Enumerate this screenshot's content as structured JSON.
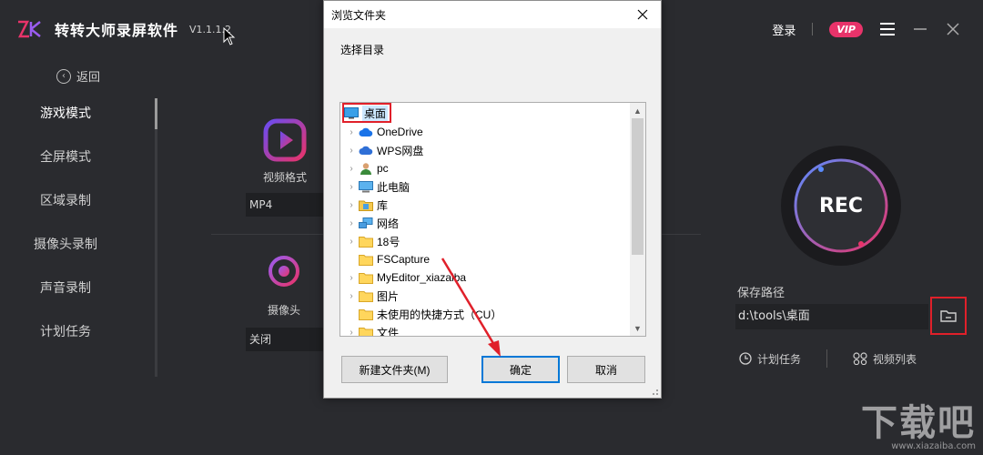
{
  "app": {
    "title": "转转大师录屏软件",
    "version": "V1.1.1.2",
    "login": "登录",
    "vip": "VIP",
    "back": "返回"
  },
  "sidebar": {
    "items": [
      {
        "label": "游戏模式",
        "active": true
      },
      {
        "label": "全屏模式"
      },
      {
        "label": "区域录制"
      },
      {
        "label": "摄像头录制"
      },
      {
        "label": "声音录制"
      },
      {
        "label": "计划任务"
      }
    ]
  },
  "main": {
    "video_format_label": "视频格式",
    "video_format_value": "MP4",
    "camera_label": "摄像头",
    "camera_value": "关闭",
    "rec_label": "REC",
    "save_path_label": "保存路径",
    "save_path_value": "d:\\tools\\桌面",
    "schedule_label": "计划任务",
    "video_list_label": "视频列表"
  },
  "dialog": {
    "title": "浏览文件夹",
    "prompt": "选择目录",
    "root": "桌面",
    "items": [
      {
        "label": "OneDrive",
        "icon": "cloud-icon"
      },
      {
        "label": "WPS网盘",
        "icon": "cloud-icon"
      },
      {
        "label": "pc",
        "icon": "user-icon"
      },
      {
        "label": "此电脑",
        "icon": "computer-icon"
      },
      {
        "label": "库",
        "icon": "library-icon"
      },
      {
        "label": "网络",
        "icon": "network-icon"
      },
      {
        "label": "18号",
        "icon": "folder-icon"
      },
      {
        "label": "FSCapture",
        "icon": "folder-icon"
      },
      {
        "label": "MyEditor_xiazaiba",
        "icon": "folder-icon"
      },
      {
        "label": "图片",
        "icon": "folder-icon"
      },
      {
        "label": "未使用的快捷方式（CU）",
        "icon": "folder-icon"
      },
      {
        "label": "文件",
        "icon": "folder-icon"
      }
    ],
    "new_folder": "新建文件夹(M)",
    "ok": "确定",
    "cancel": "取消"
  },
  "watermark": {
    "main": "下载吧",
    "sub": "www.xiazaiba.com"
  },
  "colors": {
    "accent": "#e8336a",
    "highlight": "#e0202a",
    "primary_blue": "#0078d7"
  }
}
